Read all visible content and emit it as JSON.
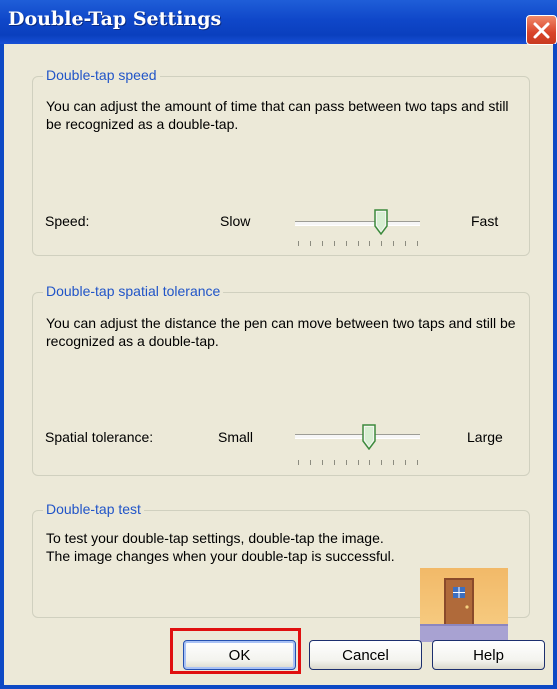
{
  "window": {
    "title": "Double-Tap Settings",
    "close_icon": "close-icon"
  },
  "speed_group": {
    "legend": "Double-tap speed",
    "description": "You can adjust the amount of time that can pass between two taps and still be recognized as a double-tap.",
    "label": "Speed:",
    "min_label": "Slow",
    "max_label": "Fast",
    "slider_value": 0.7,
    "tick_count": 11
  },
  "tolerance_group": {
    "legend": "Double-tap spatial tolerance",
    "description": "You can adjust the distance the pen can move between two taps and still be recognized as a double-tap.",
    "label": "Spatial tolerance:",
    "min_label": "Small",
    "max_label": "Large",
    "slider_value": 0.6,
    "tick_count": 11
  },
  "test_group": {
    "legend": "Double-tap test",
    "description": "To test your double-tap settings, double-tap the image. The image changes when your double-tap is successful.",
    "image_icon": "door-icon"
  },
  "buttons": {
    "ok": "OK",
    "cancel": "Cancel",
    "help": "Help"
  },
  "colors": {
    "titlebar": "#0f47c9",
    "legend_text": "#2155c8",
    "highlight": "#e01010"
  }
}
